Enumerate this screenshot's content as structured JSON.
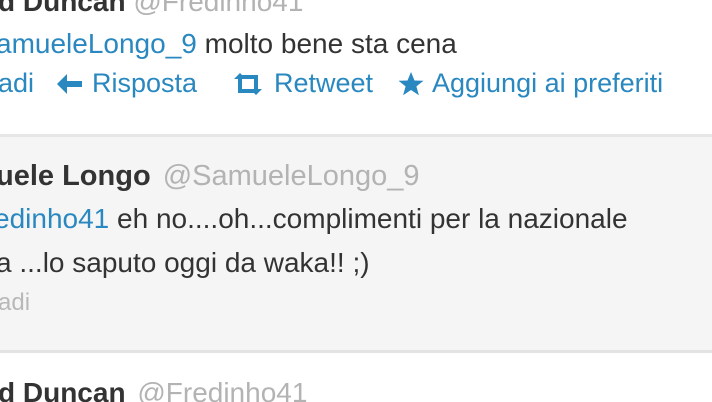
{
  "tweets": [
    {
      "name": "d Duncan",
      "handle": "@Fredinho41",
      "mention": "amueleLongo_9",
      "text": " molto bene sta cena",
      "actions": {
        "expand": "adi",
        "reply": "Risposta",
        "retweet": "Retweet",
        "favorite": "Aggiungi ai preferiti"
      }
    },
    {
      "name": "uele Longo",
      "handle": "@SamueleLongo_9",
      "mention": "edinho41",
      "text_line1": " eh no....oh...complimenti per la nazionale",
      "text_line2": "a ...lo saputo oggi da waka!! ;)",
      "expand": "adi"
    },
    {
      "name": "d Duncan",
      "handle": "@Fredinho41"
    }
  ],
  "icons": {
    "reply": "reply-arrow-icon",
    "retweet": "retweet-icon",
    "favorite": "star-icon"
  },
  "colors": {
    "link": "#2a88c0",
    "handle": "#b3b3b3",
    "text": "#333333",
    "selected_bg": "#f5f5f5"
  }
}
